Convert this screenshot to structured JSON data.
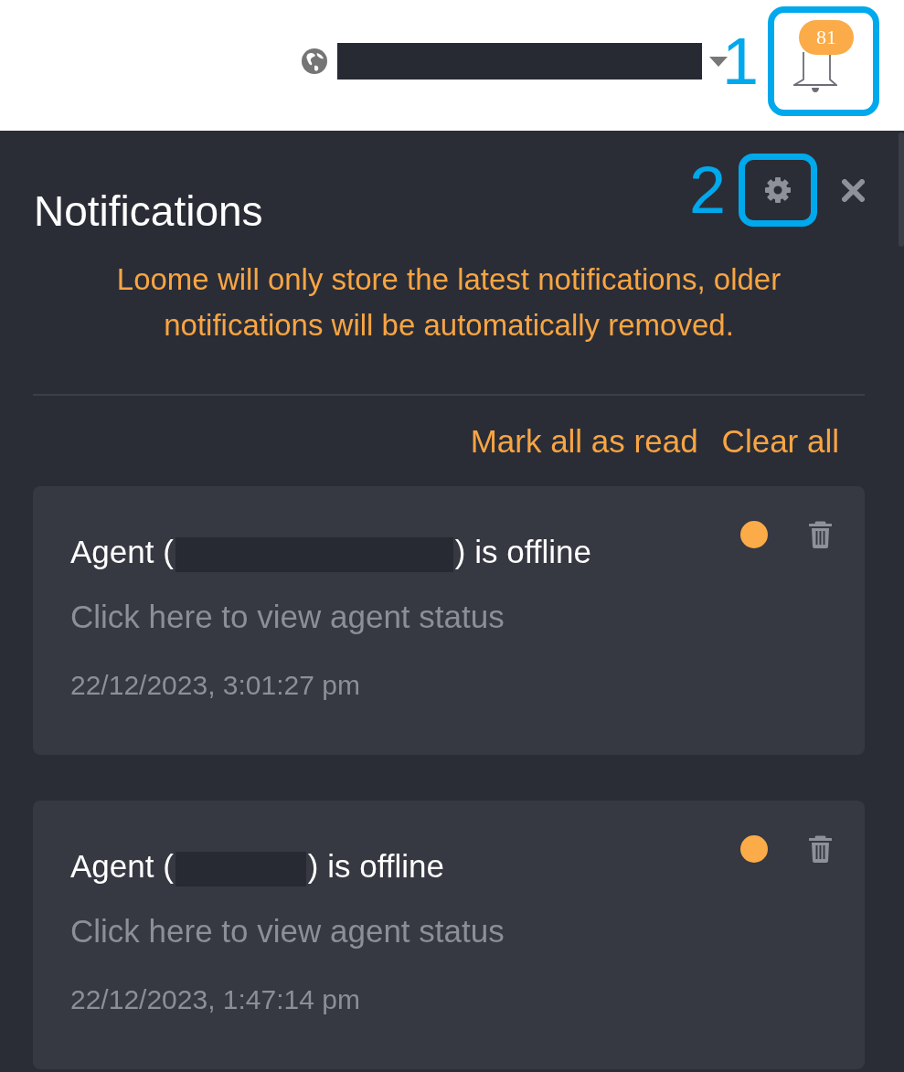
{
  "top_bar": {
    "annotation": "1",
    "notifications": {
      "badge": "81"
    }
  },
  "panel": {
    "title": "Notifications",
    "annotation": "2",
    "notice": "Loome will only store the latest notifications, older notifications will be automatically removed.",
    "actions": [
      {
        "label": "Mark all as read"
      },
      {
        "label": "Clear all"
      }
    ],
    "items": [
      {
        "title_start": "Agent (",
        "title_end": ") is offline",
        "link": "Click here to view agent status",
        "time": "22/12/2023, 3:01:27 pm",
        "unread": true
      },
      {
        "title_start": "Agent (",
        "title_end": ") is offline",
        "link": "Click here to view agent status",
        "time": "22/12/2023, 1:47:14 pm",
        "unread": true
      }
    ]
  }
}
